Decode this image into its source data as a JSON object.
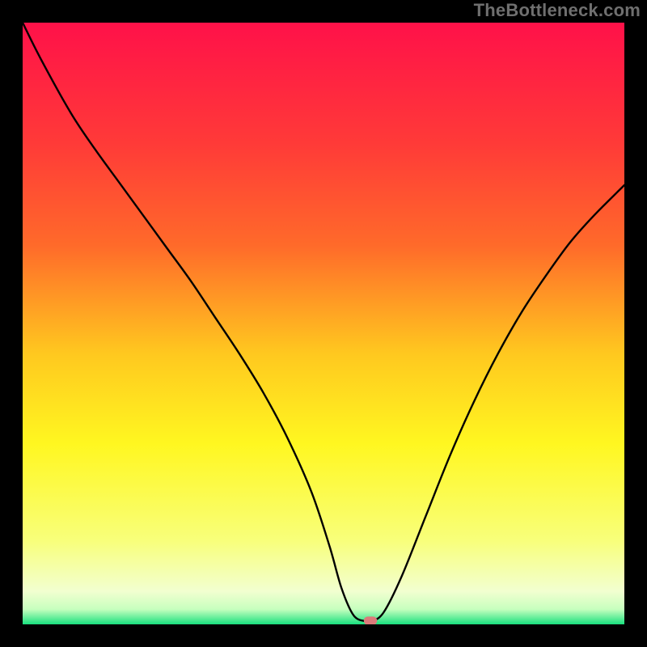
{
  "watermark": "TheBottleneck.com",
  "chart_data": {
    "type": "line",
    "title": "",
    "xlabel": "",
    "ylabel": "",
    "xlim": [
      0,
      100
    ],
    "ylim": [
      0,
      100
    ],
    "grid": false,
    "background_gradient": {
      "top_color": "#ff1149",
      "mid_colors": [
        "#ff6a2a",
        "#ffc81f",
        "#fff720",
        "#f8ff7a",
        "#f2ffd0"
      ],
      "bottom_color": "#19e07e"
    },
    "series": [
      {
        "name": "bottleneck-curve",
        "color": "#000000",
        "x": [
          0,
          3,
          8,
          12,
          16,
          20,
          24,
          28,
          32,
          36,
          40,
          44,
          48,
          51,
          53,
          55,
          57,
          58,
          60,
          63,
          67,
          71,
          75,
          79,
          83,
          87,
          91,
          95,
          100
        ],
        "y": [
          100,
          94,
          85,
          79,
          73.5,
          68,
          62.5,
          57,
          51,
          45,
          38.5,
          31,
          22,
          13,
          6,
          1.5,
          0.5,
          0.5,
          2,
          8,
          18,
          28,
          37,
          45,
          52,
          58,
          63.5,
          68,
          73
        ]
      }
    ],
    "marker": {
      "name": "optimal-point",
      "x": 57.8,
      "y": 0.6,
      "width_pct": 2.2,
      "height_pct": 1.4,
      "fill": "#db7a7a"
    }
  }
}
